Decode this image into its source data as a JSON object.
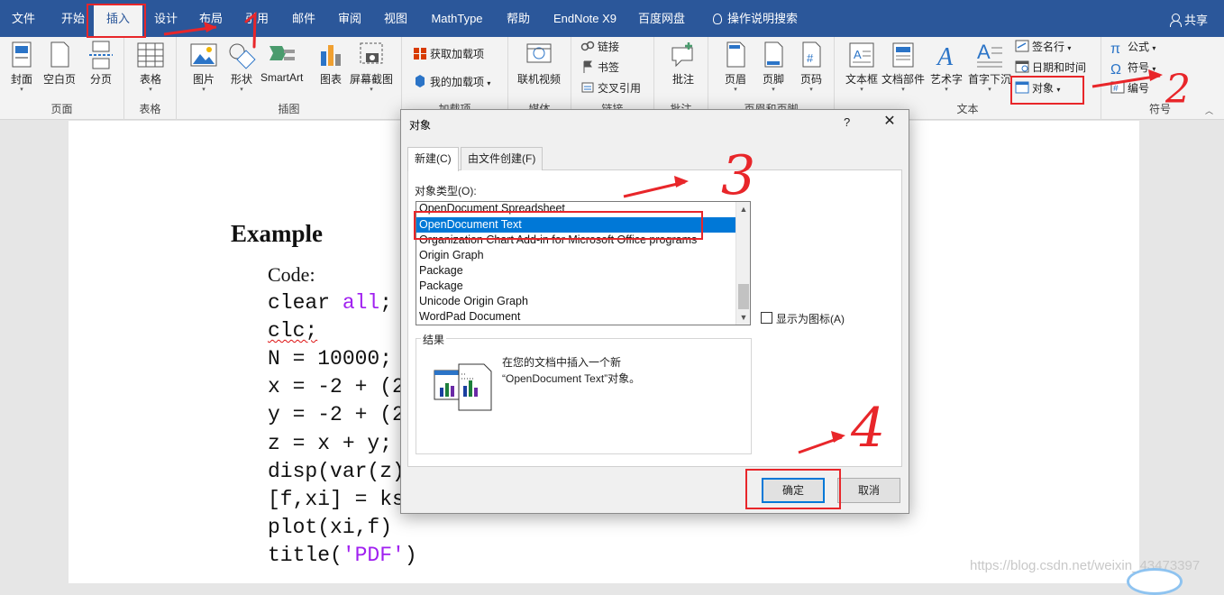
{
  "menubar": {
    "tabs": [
      "文件",
      "开始",
      "插入",
      "设计",
      "布局",
      "引用",
      "邮件",
      "审阅",
      "视图",
      "MathType",
      "帮助",
      "EndNote X9",
      "百度网盘"
    ],
    "active_tab": "插入",
    "tell_me": "操作说明搜索",
    "share": "共享"
  },
  "ribbon": {
    "groups": {
      "pages": {
        "label": "页面",
        "buttons": [
          "封面",
          "空白页",
          "分页"
        ]
      },
      "tables": {
        "label": "表格",
        "buttons": [
          "表格"
        ]
      },
      "illustrations": {
        "label": "插图",
        "buttons": [
          "图片",
          "形状",
          "SmartArt",
          "图表",
          "屏幕截图"
        ]
      },
      "addins": {
        "label": "加载项",
        "buttons": [
          "获取加载项",
          "我的加载项"
        ]
      },
      "media": {
        "label": "媒体",
        "buttons": [
          "联机视频"
        ]
      },
      "links": {
        "label": "链接",
        "buttons": [
          "链接",
          "书签",
          "交叉引用"
        ]
      },
      "comments": {
        "label": "批注",
        "buttons": [
          "批注"
        ]
      },
      "header_footer": {
        "label": "页眉和页脚",
        "buttons": [
          "页眉",
          "页脚",
          "页码"
        ]
      },
      "text": {
        "label": "文本",
        "buttons": [
          "文本框",
          "文档部件",
          "艺术字",
          "首字下沉",
          "签名行",
          "日期和时间",
          "对象"
        ]
      },
      "symbols": {
        "label": "符号",
        "buttons": [
          "公式",
          "符号",
          "编号"
        ]
      }
    }
  },
  "document": {
    "heading": "Example",
    "code_label": "Code:",
    "code_lines": [
      [
        "clear ",
        "all",
        ";"
      ],
      [
        "clc;"
      ],
      [
        "N = 10000;"
      ],
      [
        "x = -2 + (2"
      ],
      [
        "y = -2 + (2"
      ],
      [
        "z = x + y;"
      ],
      [
        "disp(var(z)"
      ],
      [
        "[f,xi] = ks"
      ],
      [
        "plot(xi,f)"
      ],
      [
        "title(",
        "'PDF'",
        ")"
      ]
    ],
    "watermark": "https://blog.csdn.net/weixin_43473397"
  },
  "dialog": {
    "title": "对象",
    "help": "?",
    "close": "✕",
    "tabs": [
      "新建(C)",
      "由文件创建(F)"
    ],
    "object_type_label": "对象类型(O):",
    "list_items": [
      "OpenDocument Spreadsheet",
      "OpenDocument Text",
      "Organization Chart Add-in for Microsoft Office programs",
      "Origin Graph",
      "Package",
      "Package",
      "Unicode Origin Graph",
      "WordPad Document"
    ],
    "selected_item": "OpenDocument Text",
    "display_as_icon": "显示为图标(A)",
    "display_as_icon_checked": false,
    "result_label": "结果",
    "result_text_1": "在您的文档中插入一个新",
    "result_text_2": "“OpenDocument Text”对象。",
    "ok": "确定",
    "cancel": "取消"
  },
  "annotations": [
    "2",
    "3",
    "4"
  ],
  "colors": {
    "titlebar": "#2b579a",
    "selection": "#0078d7",
    "annotation": "#e8262a",
    "keyword": "#a020f0"
  }
}
